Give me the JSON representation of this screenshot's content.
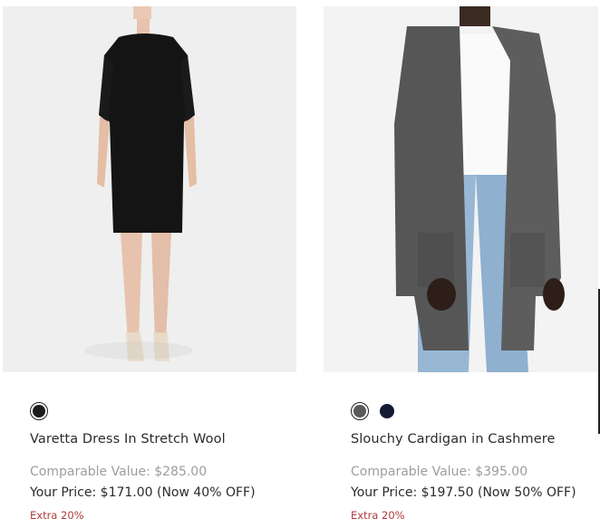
{
  "products": [
    {
      "name": "Varetta Dress In Stretch Wool",
      "image_alt": "Black fitted dress",
      "swatches": [
        {
          "color": "#1c1c1c",
          "selected": true
        }
      ],
      "comparable_value": "Comparable Value: $285.00",
      "your_price": "Your Price: $171.00 (Now 40% OFF)",
      "extra": "Extra 20%"
    },
    {
      "name": "Slouchy Cardigan in Cashmere",
      "image_alt": "Charcoal long cashmere cardigan",
      "swatches": [
        {
          "color": "#5a5a5a",
          "selected": true
        },
        {
          "color": "#141a33",
          "selected": false
        }
      ],
      "comparable_value": "Comparable Value: $395.00",
      "your_price": "Your Price: $197.50 (Now 50% OFF)",
      "extra": "Extra 20%"
    }
  ],
  "colors": {
    "comparable": "#9d9d9d",
    "extra": "#b23a3a",
    "text": "#2b2b2b"
  }
}
